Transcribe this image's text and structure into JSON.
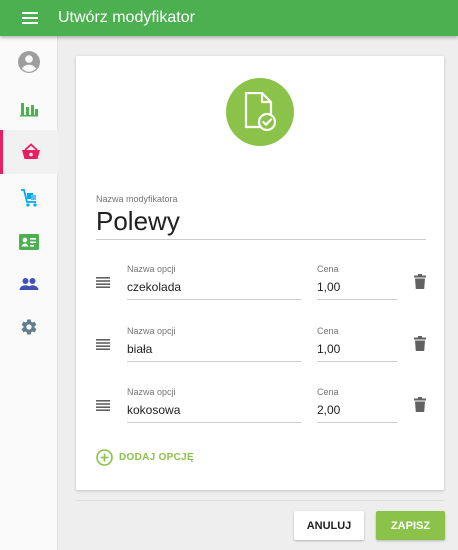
{
  "header": {
    "title": "Utwórz modyfikator",
    "menu_icon": "hamburger-menu-icon"
  },
  "sidebar": {
    "items": [
      {
        "name": "profile",
        "icon": "account-circle-icon",
        "active": false
      },
      {
        "name": "reports",
        "icon": "bar-chart-icon",
        "active": false
      },
      {
        "name": "shop",
        "icon": "basket-icon",
        "active": true
      },
      {
        "name": "delivery",
        "icon": "cart-icon",
        "active": false
      },
      {
        "name": "contacts",
        "icon": "contact-card-icon",
        "active": false
      },
      {
        "name": "users",
        "icon": "people-icon",
        "active": false
      },
      {
        "name": "settings",
        "icon": "gear-icon",
        "active": false
      }
    ]
  },
  "form": {
    "modifier_name_label": "Nazwa modyfikatora",
    "modifier_name_value": "Polewy",
    "options": [
      {
        "name_label": "Nazwa opcji",
        "name_value": "czekolada",
        "price_label": "Cena",
        "price_value": "1,00"
      },
      {
        "name_label": "Nazwa opcji",
        "name_value": "biała",
        "price_label": "Cena",
        "price_value": "1,00"
      },
      {
        "name_label": "Nazwa opcji",
        "name_value": "kokosowa",
        "price_label": "Cena",
        "price_value": "2,00"
      }
    ],
    "add_option_label": "DODAJ OPCJĘ"
  },
  "actions": {
    "cancel_label": "ANULUJ",
    "save_label": "ZAPISZ"
  },
  "colors": {
    "primary": "#4caf50",
    "accent": "#8bc34a",
    "active_indicator": "#e91e63",
    "icon_reports": "#4caf50",
    "icon_shop": "#e91e63",
    "icon_delivery": "#03a9f4",
    "icon_contacts": "#4caf50",
    "icon_users": "#3f51b5",
    "icon_settings": "#607d8b"
  }
}
